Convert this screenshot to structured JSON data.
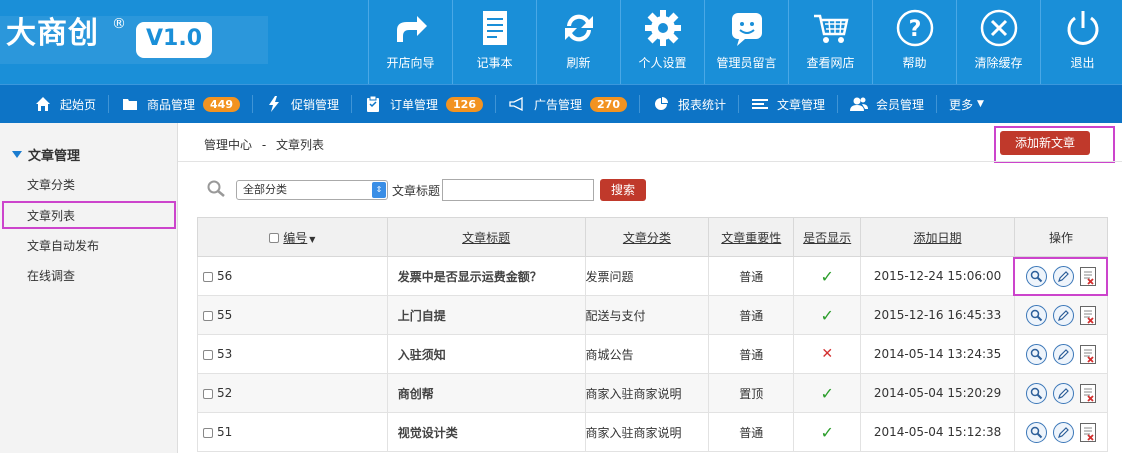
{
  "brand": {
    "name": "大商创",
    "reg": "®",
    "version": "V1.0",
    "accent": "#1a8fd8"
  },
  "toolbar": [
    {
      "label": "开店向导",
      "icon": "share-arrow-icon"
    },
    {
      "label": "记事本",
      "icon": "notepad-icon"
    },
    {
      "label": "刷新",
      "icon": "refresh-icon"
    },
    {
      "label": "个人设置",
      "icon": "gear-icon"
    },
    {
      "label": "管理员留言",
      "icon": "message-smile-icon"
    },
    {
      "label": "查看网店",
      "icon": "cart-icon"
    },
    {
      "label": "帮助",
      "icon": "help-icon"
    },
    {
      "label": "清除缓存",
      "icon": "clear-icon"
    },
    {
      "label": "退出",
      "icon": "power-icon"
    }
  ],
  "nav": [
    {
      "label": "起始页",
      "icon": "home-icon"
    },
    {
      "label": "商品管理",
      "icon": "folder-icon",
      "badge": "449"
    },
    {
      "label": "促销管理",
      "icon": "lightning-icon"
    },
    {
      "label": "订单管理",
      "icon": "clipboard-icon",
      "badge": "126"
    },
    {
      "label": "广告管理",
      "icon": "megaphone-icon",
      "badge": "270"
    },
    {
      "label": "报表统计",
      "icon": "pie-chart-icon"
    },
    {
      "label": "文章管理",
      "icon": "list-icon"
    },
    {
      "label": "会员管理",
      "icon": "users-icon"
    },
    {
      "label": "更多",
      "icon": "caret-down-icon"
    }
  ],
  "sidebar": {
    "section": "文章管理",
    "items": [
      "文章分类",
      "文章列表",
      "文章自动发布",
      "在线调查"
    ]
  },
  "breadcrumb": [
    "管理中心",
    "-",
    "文章列表"
  ],
  "add_button": "添加新文章",
  "search": {
    "category": "全部分类",
    "title_label": "文章标题",
    "button": "搜索"
  },
  "table": {
    "headers": {
      "id": "编号",
      "title": "文章标题",
      "category": "文章分类",
      "importance": "文章重要性",
      "show": "是否显示",
      "date": "添加日期",
      "ops": "操作"
    },
    "rows": [
      {
        "id": "56",
        "title": "发票中是否显示运费金额？",
        "category": "发票问题",
        "importance": "普通",
        "show": true,
        "date": "2015-12-24 15:06:00"
      },
      {
        "id": "55",
        "title": "上门自提",
        "category": "配送与支付",
        "importance": "普通",
        "show": true,
        "date": "2015-12-16 16:45:33"
      },
      {
        "id": "53",
        "title": "入驻须知",
        "category": "商城公告",
        "importance": "普通",
        "show": false,
        "date": "2014-05-14 13:24:35"
      },
      {
        "id": "52",
        "title": "商创帮",
        "category": "商家入驻商家说明",
        "importance": "置顶",
        "show": true,
        "date": "2014-05-04 15:20:29"
      },
      {
        "id": "51",
        "title": "视觉设计类",
        "category": "商家入驻商家说明",
        "importance": "普通",
        "show": true,
        "date": "2014-05-04 15:12:38"
      }
    ]
  }
}
